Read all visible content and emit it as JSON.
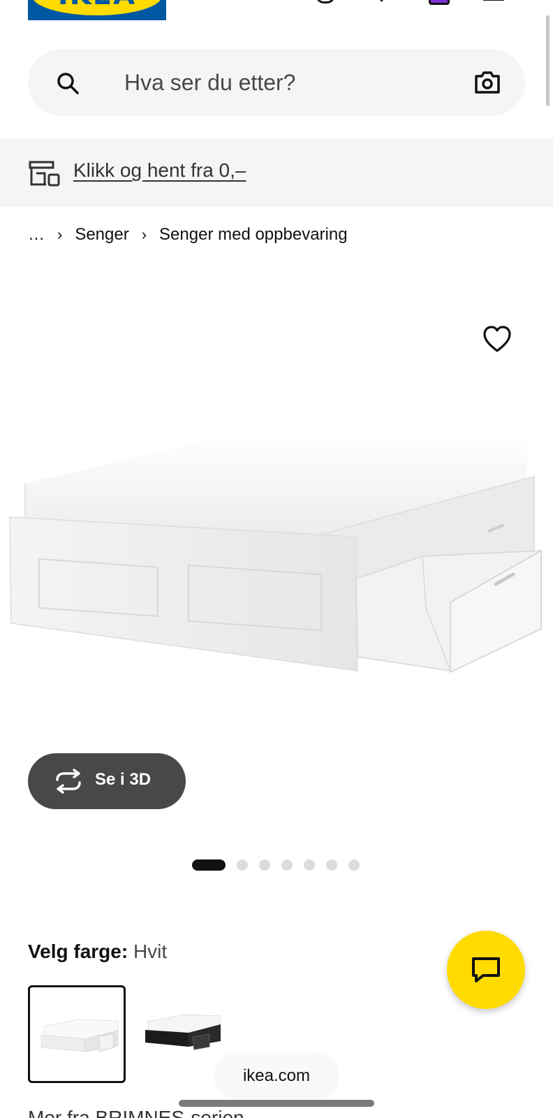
{
  "header": {
    "logo_text": "IKEA",
    "icons": [
      "user-icon",
      "heart-icon",
      "shopping-bag-icon",
      "menu-icon"
    ]
  },
  "search": {
    "placeholder": "Hva ser du etter?",
    "icons": [
      "search-icon",
      "camera-icon"
    ]
  },
  "promo": {
    "text": "Klikk og hent fra 0,–",
    "icon": "store-pickup-icon"
  },
  "breadcrumb": {
    "items": [
      "…",
      "Senger",
      "Senger med oppbevaring"
    ]
  },
  "product": {
    "image_alt": "BRIMNES seng med oppbevaring, hvit",
    "view_3d_label": "Se i 3D",
    "gallery": {
      "total": 7,
      "active_index": 0
    }
  },
  "color_selector": {
    "label": "Velg farge:",
    "selected": "Hvit",
    "options": [
      {
        "color": "white",
        "selected": true
      },
      {
        "color": "black",
        "selected": false
      }
    ]
  },
  "more_series": "Mer fra BRIMNES-serien",
  "browser": {
    "url": "ikea.com"
  },
  "colors": {
    "ikea_blue": "#0058a3",
    "ikea_yellow": "#ffdb00",
    "dark_button": "#484848",
    "light_bg": "#f5f5f5",
    "bag_purple": "#7e2fd6"
  }
}
